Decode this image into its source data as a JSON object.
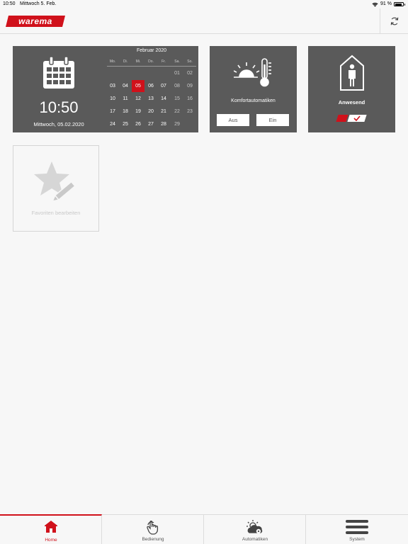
{
  "status_bar": {
    "time": "10:50",
    "date": "Mittwoch 5. Feb.",
    "battery": "91 %",
    "icons": [
      "wifi-icon",
      "battery-icon"
    ]
  },
  "header": {
    "logo_text": "warema",
    "refresh_icon": "refresh-icon"
  },
  "calendar_card": {
    "icon": "calendar-icon",
    "time": "10:50",
    "date": "Mittwoch, 05.02.2020",
    "month": "Februar 2020",
    "weekdays": [
      "Mo.",
      "Di.",
      "Mi.",
      "Do.",
      "Fr.",
      "Sa.",
      "So."
    ],
    "weeks": [
      [
        "",
        "",
        "",
        "",
        "",
        "01",
        "02"
      ],
      [
        "03",
        "04",
        "05",
        "06",
        "07",
        "08",
        "09"
      ],
      [
        "10",
        "11",
        "12",
        "13",
        "14",
        "15",
        "16"
      ],
      [
        "17",
        "18",
        "19",
        "20",
        "21",
        "22",
        "23"
      ],
      [
        "24",
        "25",
        "26",
        "27",
        "28",
        "29",
        ""
      ]
    ],
    "today": "05"
  },
  "comfort_card": {
    "icon": "sun-thermometer-icon",
    "label": "Komfortautomatiken",
    "off_label": "Aus",
    "on_label": "Ein"
  },
  "presence_card": {
    "icon": "house-person-icon",
    "label": "Anwesend",
    "toggle_state": true
  },
  "favorites_card": {
    "icon": "star-pencil-icon",
    "label": "Favoriten bearbeiten"
  },
  "tabs": [
    {
      "label": "Home",
      "icon": "home-icon",
      "active": true
    },
    {
      "label": "Bedienung",
      "icon": "hand-touch-icon",
      "active": false
    },
    {
      "label": "Automatiken",
      "icon": "weather-gear-icon",
      "active": false
    },
    {
      "label": "System",
      "icon": "list-icon",
      "active": false
    }
  ],
  "colors": {
    "accent": "#d0111b",
    "card_bg": "#5a5a5a",
    "page_bg": "#f7f7f7"
  }
}
